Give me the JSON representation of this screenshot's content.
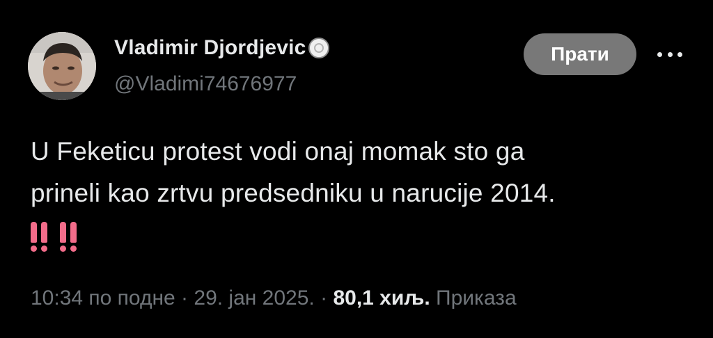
{
  "tweet": {
    "author": {
      "display_name": "Vladimir Djordjevic",
      "handle": "@Vladimi74676977",
      "avatar_icon": "profile-photo",
      "badge_icon": "verified-badge-icon"
    },
    "follow_label": "Прати",
    "more_icon": "more-options-icon",
    "text_lines": [
      "U Feketicu protest vodi onaj momak sto ga",
      "prineli kao zrtvu predsedniku u narucije 2014."
    ],
    "emoji": "‼️‼️",
    "time": "10:34 по подне",
    "separator": "·",
    "date": "29. јан 2025.",
    "views_count": "80,1 хиљ.",
    "views_label": "Приказа"
  },
  "colors": {
    "background": "#000000",
    "primary_text": "#e7e9ea",
    "secondary_text": "#71767b",
    "follow_button_bg": "#787878",
    "emoji_red": "#f26c8a"
  }
}
